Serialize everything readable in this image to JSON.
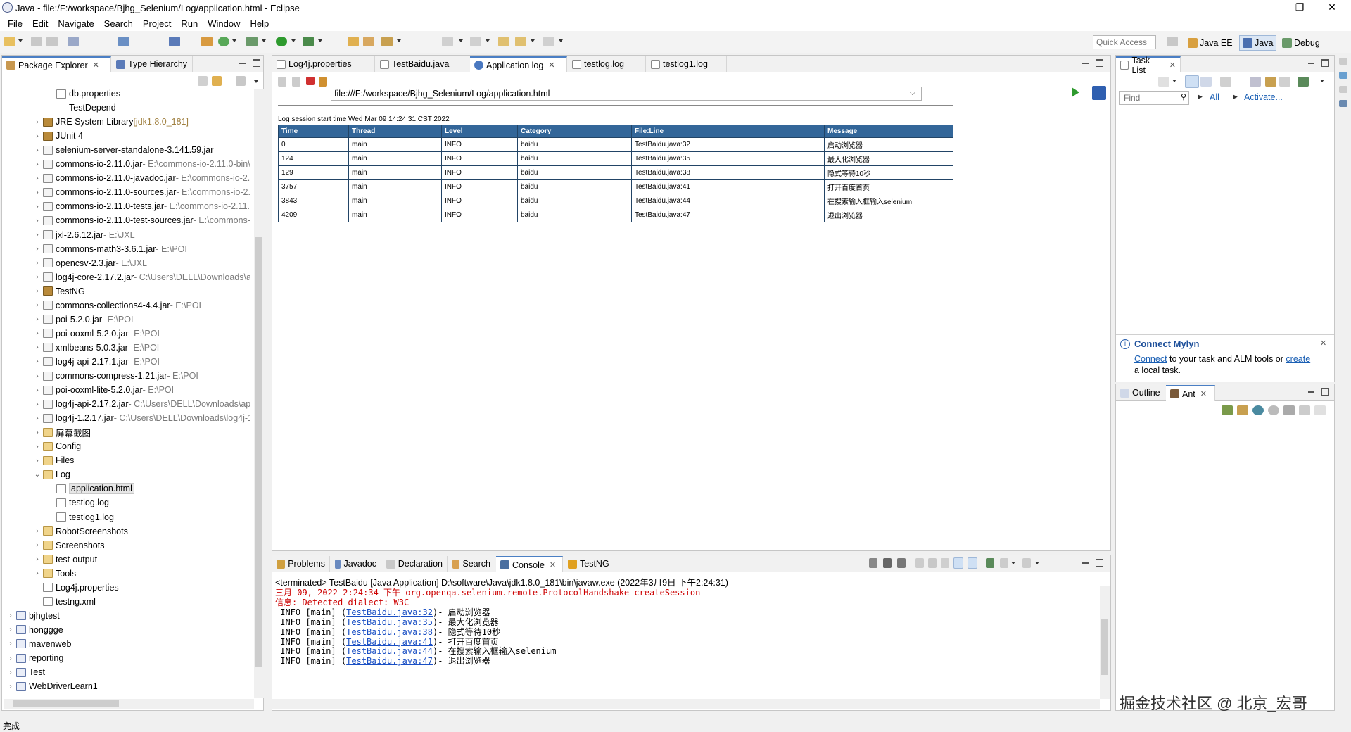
{
  "window": {
    "title": "Java - file:/F:/workspace/Bjhg_Selenium/Log/application.html - Eclipse",
    "minimize": "–",
    "maximize": "❐",
    "close": "✕"
  },
  "menu": [
    "File",
    "Edit",
    "Navigate",
    "Search",
    "Project",
    "Run",
    "Window",
    "Help"
  ],
  "toolbar": {
    "quick_access_placeholder": "Quick Access",
    "perspectives": [
      "Java EE",
      "Java",
      "Debug"
    ]
  },
  "left_panel": {
    "tabs": [
      "Package Explorer",
      "Type Hierarchy"
    ],
    "tree": [
      {
        "label": "db.properties",
        "deco": "",
        "indent": 3,
        "twisty": "",
        "icon": "file"
      },
      {
        "label": "TestDepend",
        "deco": "",
        "indent": 3,
        "twisty": "",
        "icon": "none"
      },
      {
        "label": "JRE System Library",
        "deco": " [jdk1.8.0_181]",
        "indent": 2,
        "twisty": ">",
        "icon": "lib"
      },
      {
        "label": "JUnit 4",
        "deco": "",
        "indent": 2,
        "twisty": ">",
        "icon": "lib"
      },
      {
        "label": "selenium-server-standalone-3.141.59.jar",
        "deco": "",
        "indent": 2,
        "twisty": ">",
        "icon": "jar"
      },
      {
        "label": "commons-io-2.11.0.jar",
        "deco": " - E:\\commons-io-2.11.0-bin\\",
        "indent": 2,
        "twisty": ">",
        "icon": "jar"
      },
      {
        "label": "commons-io-2.11.0-javadoc.jar",
        "deco": " - E:\\commons-io-2.",
        "indent": 2,
        "twisty": ">",
        "icon": "jar"
      },
      {
        "label": "commons-io-2.11.0-sources.jar",
        "deco": " - E:\\commons-io-2.",
        "indent": 2,
        "twisty": ">",
        "icon": "jar"
      },
      {
        "label": "commons-io-2.11.0-tests.jar",
        "deco": " - E:\\commons-io-2.11.",
        "indent": 2,
        "twisty": ">",
        "icon": "jar"
      },
      {
        "label": "commons-io-2.11.0-test-sources.jar",
        "deco": " - E:\\commons-",
        "indent": 2,
        "twisty": ">",
        "icon": "jar"
      },
      {
        "label": "jxl-2.6.12.jar",
        "deco": " - E:\\JXL",
        "indent": 2,
        "twisty": ">",
        "icon": "jar"
      },
      {
        "label": "commons-math3-3.6.1.jar",
        "deco": " - E:\\POI",
        "indent": 2,
        "twisty": ">",
        "icon": "jar"
      },
      {
        "label": "opencsv-2.3.jar",
        "deco": " - E:\\JXL",
        "indent": 2,
        "twisty": ">",
        "icon": "jar"
      },
      {
        "label": "log4j-core-2.17.2.jar",
        "deco": " - C:\\Users\\DELL\\Downloads\\a|",
        "indent": 2,
        "twisty": ">",
        "icon": "jar"
      },
      {
        "label": "TestNG",
        "deco": "",
        "indent": 2,
        "twisty": ">",
        "icon": "lib"
      },
      {
        "label": "commons-collections4-4.4.jar",
        "deco": " - E:\\POI",
        "indent": 2,
        "twisty": ">",
        "icon": "jar"
      },
      {
        "label": "poi-5.2.0.jar",
        "deco": " - E:\\POI",
        "indent": 2,
        "twisty": ">",
        "icon": "jar"
      },
      {
        "label": "poi-ooxml-5.2.0.jar",
        "deco": " - E:\\POI",
        "indent": 2,
        "twisty": ">",
        "icon": "jar"
      },
      {
        "label": "xmlbeans-5.0.3.jar",
        "deco": " - E:\\POI",
        "indent": 2,
        "twisty": ">",
        "icon": "jar"
      },
      {
        "label": "log4j-api-2.17.1.jar",
        "deco": " - E:\\POI",
        "indent": 2,
        "twisty": ">",
        "icon": "jar"
      },
      {
        "label": "commons-compress-1.21.jar",
        "deco": " - E:\\POI",
        "indent": 2,
        "twisty": ">",
        "icon": "jar"
      },
      {
        "label": "poi-ooxml-lite-5.2.0.jar",
        "deco": " - E:\\POI",
        "indent": 2,
        "twisty": ">",
        "icon": "jar"
      },
      {
        "label": "log4j-api-2.17.2.jar",
        "deco": " - C:\\Users\\DELL\\Downloads\\ap",
        "indent": 2,
        "twisty": ">",
        "icon": "jar"
      },
      {
        "label": "log4j-1.2.17.jar",
        "deco": " - C:\\Users\\DELL\\Downloads\\log4j-1",
        "indent": 2,
        "twisty": ">",
        "icon": "jar"
      },
      {
        "label": "屏幕截图",
        "deco": "",
        "indent": 2,
        "twisty": ">",
        "icon": "folder"
      },
      {
        "label": "Config",
        "deco": "",
        "indent": 2,
        "twisty": ">",
        "icon": "folder"
      },
      {
        "label": "Files",
        "deco": "",
        "indent": 2,
        "twisty": ">",
        "icon": "folder"
      },
      {
        "label": "Log",
        "deco": "",
        "indent": 2,
        "twisty": "v",
        "icon": "folder"
      },
      {
        "label": "application.html",
        "deco": "",
        "indent": 3,
        "twisty": "",
        "icon": "file",
        "selected": true
      },
      {
        "label": "testlog.log",
        "deco": "",
        "indent": 3,
        "twisty": "",
        "icon": "file"
      },
      {
        "label": "testlog1.log",
        "deco": "",
        "indent": 3,
        "twisty": "",
        "icon": "file"
      },
      {
        "label": "RobotScreenshots",
        "deco": "",
        "indent": 2,
        "twisty": ">",
        "icon": "folder"
      },
      {
        "label": "Screenshots",
        "deco": "",
        "indent": 2,
        "twisty": ">",
        "icon": "folder"
      },
      {
        "label": "test-output",
        "deco": "",
        "indent": 2,
        "twisty": ">",
        "icon": "folder"
      },
      {
        "label": "Tools",
        "deco": "",
        "indent": 2,
        "twisty": ">",
        "icon": "folder"
      },
      {
        "label": "Log4j.properties",
        "deco": "",
        "indent": 2,
        "twisty": "",
        "icon": "file"
      },
      {
        "label": "testng.xml",
        "deco": "",
        "indent": 2,
        "twisty": "",
        "icon": "file"
      },
      {
        "label": "bjhgtest",
        "deco": "",
        "indent": 0,
        "twisty": ">",
        "icon": "proj"
      },
      {
        "label": "honggge",
        "deco": "",
        "indent": 0,
        "twisty": ">",
        "icon": "proj"
      },
      {
        "label": "mavenweb",
        "deco": "",
        "indent": 0,
        "twisty": ">",
        "icon": "proj"
      },
      {
        "label": "reporting",
        "deco": "",
        "indent": 0,
        "twisty": ">",
        "icon": "proj"
      },
      {
        "label": "Test",
        "deco": "",
        "indent": 0,
        "twisty": ">",
        "icon": "proj"
      },
      {
        "label": "WebDriverLearn1",
        "deco": "",
        "indent": 0,
        "twisty": ">",
        "icon": "proj"
      }
    ]
  },
  "editor": {
    "tabs": [
      "Log4j.properties",
      "TestBaidu.java",
      "Application log",
      "testlog.log",
      "testlog1.log"
    ],
    "active_tab": 2,
    "url": "file:///F:/workspace/Bjhg_Selenium/Log/application.html",
    "session_text": "Log session start time Wed Mar 09 14:24:31 CST 2022",
    "table": {
      "headers": [
        "Time",
        "Thread",
        "Level",
        "Category",
        "File:Line",
        "Message"
      ],
      "rows": [
        [
          "0",
          "main",
          "INFO",
          "baidu",
          "TestBaidu.java:32",
          "启动浏览器"
        ],
        [
          "124",
          "main",
          "INFO",
          "baidu",
          "TestBaidu.java:35",
          "最大化浏览器"
        ],
        [
          "129",
          "main",
          "INFO",
          "baidu",
          "TestBaidu.java:38",
          "隐式等待10秒"
        ],
        [
          "3757",
          "main",
          "INFO",
          "baidu",
          "TestBaidu.java:41",
          "打开百度首页"
        ],
        [
          "3843",
          "main",
          "INFO",
          "baidu",
          "TestBaidu.java:44",
          "在搜索输入框输入selenium"
        ],
        [
          "4209",
          "main",
          "INFO",
          "baidu",
          "TestBaidu.java:47",
          "退出浏览器"
        ]
      ]
    }
  },
  "right_panel": {
    "task_tab": "Task List",
    "find_placeholder": "Find",
    "all_label": "All",
    "activate_label": "Activate...",
    "mylyn": {
      "title": "Connect Mylyn",
      "connect_link": "Connect",
      "text_mid": " to your task and ALM tools or ",
      "create_link": "create",
      "text_end": "a local task."
    },
    "outline_tabs": [
      "Outline",
      "Ant"
    ]
  },
  "console": {
    "tabs": [
      "Problems",
      "Javadoc",
      "Declaration",
      "Search",
      "Console",
      "TestNG"
    ],
    "active_tab": 4,
    "header": "<terminated> TestBaidu [Java Application] D:\\software\\Java\\jdk1.8.0_181\\bin\\javaw.exe (2022年3月9日 下午2:24:31)",
    "lines_red": [
      "三月 09, 2022 2:24:34 下午 org.openqa.selenium.remote.ProtocolHandshake createSession",
      "信息: Detected dialect: W3C"
    ],
    "log_lines": [
      {
        "prefix": " INFO [main] (",
        "link": "TestBaidu.java:32",
        "suffix": ")- 启动浏览器"
      },
      {
        "prefix": " INFO [main] (",
        "link": "TestBaidu.java:35",
        "suffix": ")- 最大化浏览器"
      },
      {
        "prefix": " INFO [main] (",
        "link": "TestBaidu.java:38",
        "suffix": ")- 隐式等待10秒"
      },
      {
        "prefix": " INFO [main] (",
        "link": "TestBaidu.java:41",
        "suffix": ")- 打开百度首页"
      },
      {
        "prefix": " INFO [main] (",
        "link": "TestBaidu.java:44",
        "suffix": ")- 在搜索输入框输入selenium"
      },
      {
        "prefix": " INFO [main] (",
        "link": "TestBaidu.java:47",
        "suffix": ")- 退出浏览器"
      }
    ]
  },
  "status": "完成",
  "watermark": "掘金技术社区 @ 北京_宏哥"
}
